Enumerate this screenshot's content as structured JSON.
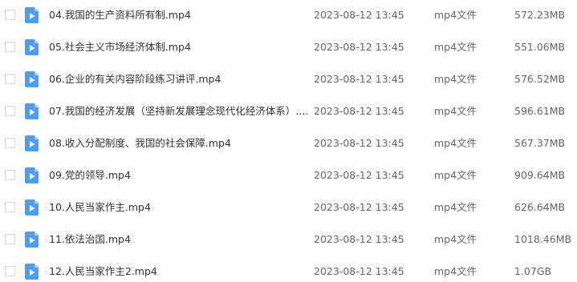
{
  "icon": {
    "name": "video-file-icon",
    "color": "#4a9cf5",
    "fold_color": "#a9cdfa",
    "play_color": "#ffffff"
  },
  "files": [
    {
      "name": "04.我国的生产资料所有制.mp4",
      "date": "2023-08-12 13:45",
      "type": "mp4文件",
      "size": "572.23MB"
    },
    {
      "name": "05.社会主义市场经济体制.mp4",
      "date": "2023-08-12 13:45",
      "type": "mp4文件",
      "size": "551.06MB"
    },
    {
      "name": "06.企业的有关内容阶段练习讲评.mp4",
      "date": "2023-08-12 13:45",
      "type": "mp4文件",
      "size": "576.52MB"
    },
    {
      "name": "07.我国的经济发展（坚持新发展理念现代化经济体系）....",
      "date": "2023-08-12 13:45",
      "type": "mp4文件",
      "size": "596.61MB"
    },
    {
      "name": "08.收入分配制度、我国的社会保障.mp4",
      "date": "2023-08-12 13:45",
      "type": "mp4文件",
      "size": "567.37MB"
    },
    {
      "name": "09.党的领导.mp4",
      "date": "2023-08-12 13:45",
      "type": "mp4文件",
      "size": "909.64MB"
    },
    {
      "name": "10.人民当家作主.mp4",
      "date": "2023-08-12 13:45",
      "type": "mp4文件",
      "size": "626.64MB"
    },
    {
      "name": "11.依法治国.mp4",
      "date": "2023-08-12 13:45",
      "type": "mp4文件",
      "size": "1018.46MB"
    },
    {
      "name": "12.人民当家作主2.mp4",
      "date": "2023-08-12 13:45",
      "type": "mp4文件",
      "size": "1.07GB"
    }
  ]
}
